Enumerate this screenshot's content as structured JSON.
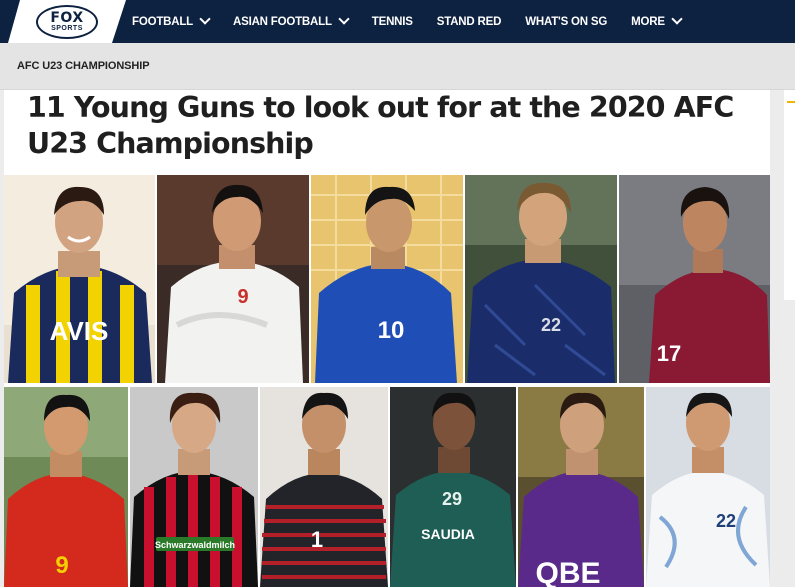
{
  "nav": {
    "logo": {
      "line1": "FOX",
      "line2": "SPORTS"
    },
    "items": [
      {
        "label": "FOOTBALL",
        "dropdown": true
      },
      {
        "label": "ASIAN FOOTBALL",
        "dropdown": true
      },
      {
        "label": "TENNIS",
        "dropdown": false
      },
      {
        "label": "STAND RED",
        "dropdown": false
      },
      {
        "label": "WHAT'S ON SG",
        "dropdown": false
      },
      {
        "label": "MORE",
        "dropdown": true
      }
    ]
  },
  "breadcrumb": "AFC U23 CHAMPIONSHIP",
  "article": {
    "title_line1": "11 Young Guns to look out for at the 2020 AFC",
    "title_line2": "U23 Championship"
  },
  "collage": {
    "players": [
      {
        "jersey": "avis-fenerbahce",
        "shirt_text": "AVIS",
        "number": ""
      },
      {
        "jersey": "vietnam-white",
        "shirt_text": "",
        "number": "9"
      },
      {
        "jersey": "thailand-blue",
        "shirt_text": "",
        "number": "10"
      },
      {
        "jersey": "japan-navy",
        "shirt_text": "",
        "number": "22"
      },
      {
        "jersey": "qatar-maroon",
        "shirt_text": "",
        "number": "17"
      },
      {
        "jersey": "china-red",
        "shirt_text": "",
        "number": "9"
      },
      {
        "jersey": "freiburg-striped",
        "shirt_text": "Schwarzwaldmilch",
        "number": ""
      },
      {
        "jersey": "shabab-striped",
        "shirt_text": "",
        "number": "1"
      },
      {
        "jersey": "al-ahli-green",
        "shirt_text": "SAUDIA",
        "number": "29"
      },
      {
        "jersey": "perth-glory-purple",
        "shirt_text": "QBE",
        "number": ""
      },
      {
        "jersey": "uzbekistan-white",
        "shirt_text": "",
        "number": "22"
      }
    ]
  },
  "colors": {
    "nav_bg": "#0d2140",
    "crumb_bg": "#e4e4e4",
    "accent": "#f2b600"
  }
}
